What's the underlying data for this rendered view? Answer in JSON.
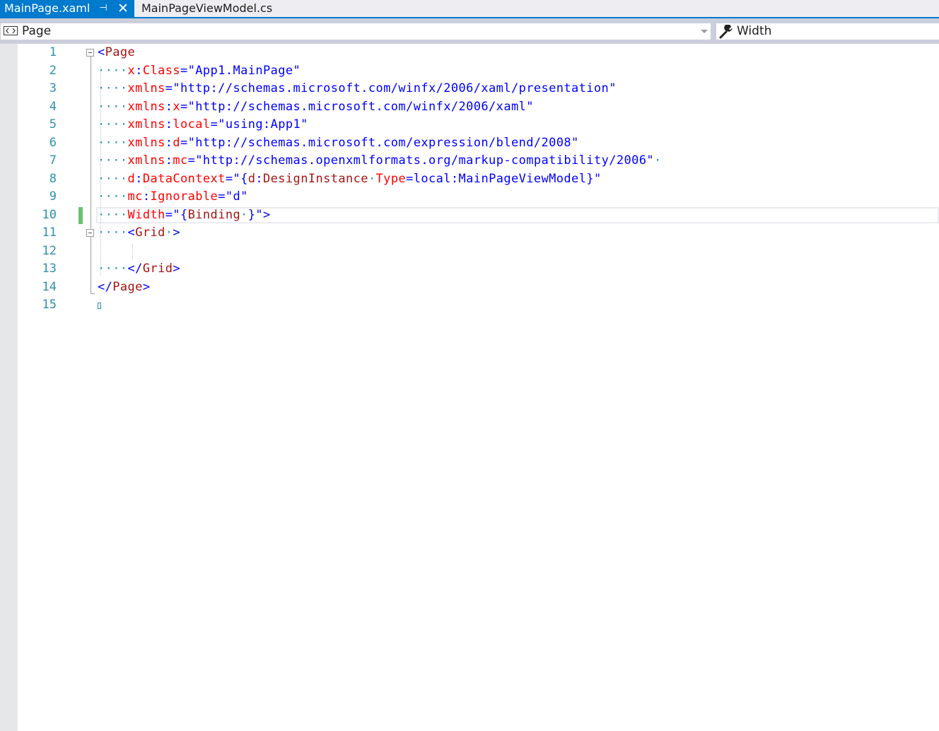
{
  "tabs": {
    "active": {
      "label": "MainPage.xaml",
      "pin_icon": "pin-icon",
      "close_icon": "close-icon"
    },
    "inactive": {
      "label": "MainPageViewModel.cs"
    }
  },
  "navbar": {
    "left_value": "Page",
    "left_icon": "element-icon",
    "right_value": "Width",
    "right_icon": "wrench-icon"
  },
  "editor": {
    "line_numbers": [
      "1",
      "2",
      "3",
      "4",
      "5",
      "6",
      "7",
      "8",
      "9",
      "10",
      "11",
      "12",
      "13",
      "14",
      "15"
    ],
    "line1": {
      "lt": "<",
      "tag": "Page"
    },
    "line2": {
      "ws": "····",
      "attr_prefix": "x",
      "colon": ":",
      "attr": "Class",
      "eq": "=",
      "val": "\"App1.MainPage\""
    },
    "line3": {
      "ws": "····",
      "attr": "xmlns",
      "eq": "=",
      "val": "\"http://schemas.microsoft.com/winfx/2006/xaml/presentation\""
    },
    "line4": {
      "ws": "····",
      "attr": "xmlns",
      "colon": ":",
      "attr2": "x",
      "eq": "=",
      "val": "\"http://schemas.microsoft.com/winfx/2006/xaml\""
    },
    "line5": {
      "ws": "····",
      "attr": "xmlns",
      "colon": ":",
      "attr2": "local",
      "eq": "=",
      "val": "\"using:App1\""
    },
    "line6": {
      "ws": "····",
      "attr": "xmlns",
      "colon": ":",
      "attr2": "d",
      "eq": "=",
      "val": "\"http://schemas.microsoft.com/expression/blend/2008\""
    },
    "line7": {
      "ws": "····",
      "attr": "xmlns",
      "colon": ":",
      "attr2": "mc",
      "eq": "=",
      "val": "\"http://schemas.openxmlformats.org/markup-compatibility/2006\"",
      "trail": "·"
    },
    "line8": {
      "ws": "····",
      "attr": "d",
      "colon": ":",
      "attr2": "DataContext",
      "eq": "=",
      "v1": "\"{",
      "t1": "d",
      "c1": ":",
      "t2": "DesignInstance",
      "dot": "·",
      "a1": "Type",
      "v2": "=local:MainPageViewModel}\""
    },
    "line9": {
      "ws": "····",
      "attr": "mc",
      "colon": ":",
      "attr2": "Ignorable",
      "eq": "=",
      "val": "\"d\""
    },
    "line10": {
      "ws": "····",
      "attr": "Width",
      "eq": "=",
      "v1": "\"{",
      "t1": "Binding",
      "dot": "·",
      "v2": "}\"",
      "gt": ">"
    },
    "line11": {
      "ws": "····",
      "lt": "<",
      "tag": "Grid",
      "dot": "·",
      "gt": ">"
    },
    "line13": {
      "ws": "····",
      "lt": "</",
      "tag": "Grid",
      "gt": ">"
    },
    "line14": {
      "lt": "</",
      "tag": "Page",
      "gt": ">"
    }
  },
  "colors": {
    "accent": "#007acc",
    "tag": "#a31515",
    "attribute": "#ff0000",
    "value": "#0000ff",
    "line_number": "#2b91af",
    "change_marker": "#6cc070"
  }
}
